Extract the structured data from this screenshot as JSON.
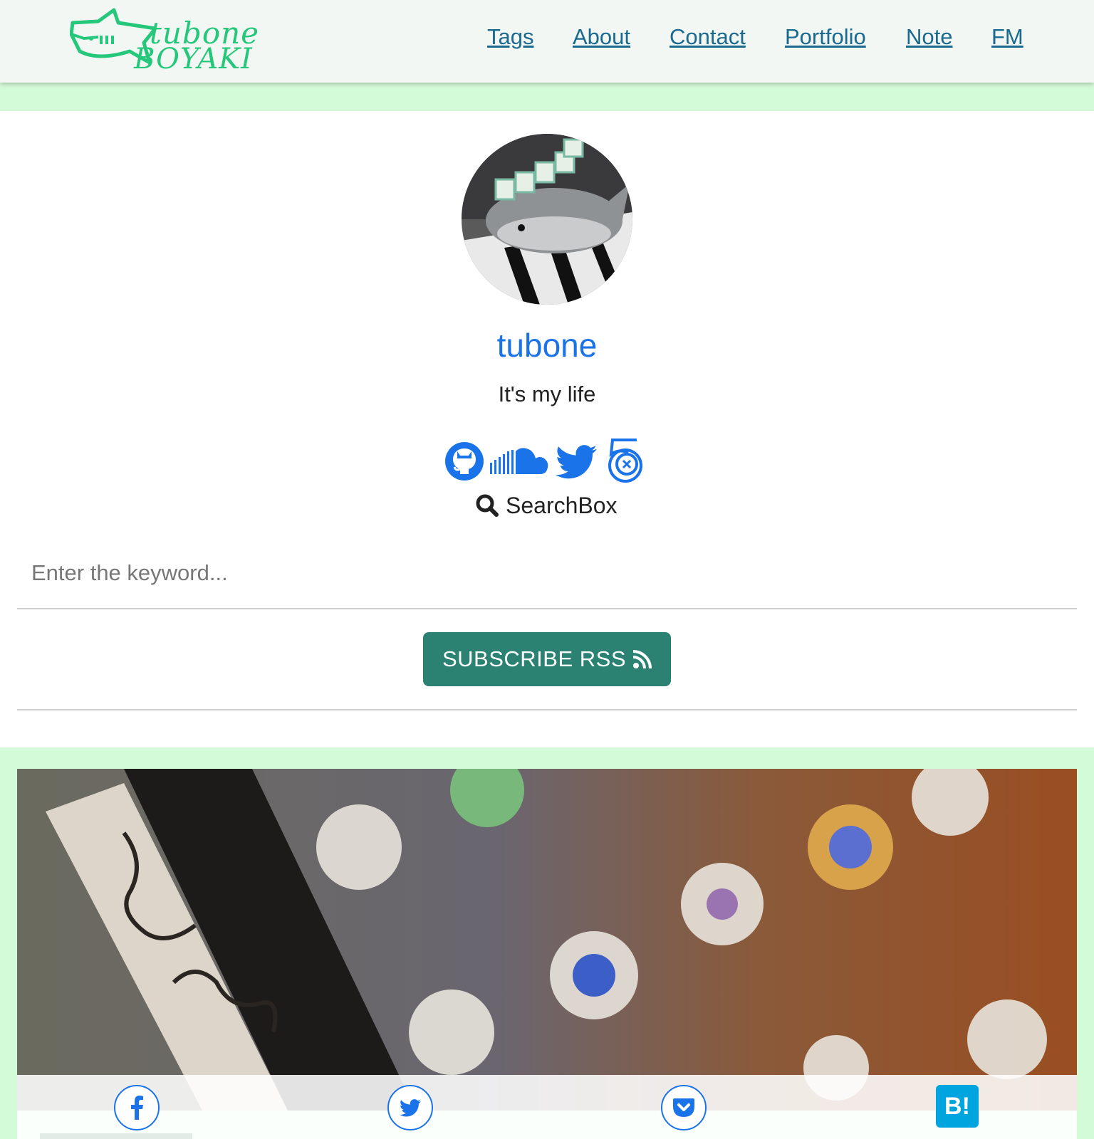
{
  "header": {
    "logo": {
      "line1": "tubone",
      "line2": "BOYAKI"
    },
    "nav": [
      {
        "label": "Tags"
      },
      {
        "label": "About"
      },
      {
        "label": "Contact"
      },
      {
        "label": "Portfolio"
      },
      {
        "label": "Note"
      },
      {
        "label": "FM"
      }
    ]
  },
  "profile": {
    "name": "tubone",
    "tagline": "It's my life",
    "social_icons": [
      "github-icon",
      "soundcloud-icon",
      "twitter-icon",
      "500px-icon"
    ]
  },
  "search": {
    "title": "SearchBox",
    "placeholder": "Enter the keyword...",
    "value": ""
  },
  "rss": {
    "label": "SUBSCRIBE RSS"
  },
  "share": {
    "buttons": [
      "facebook-icon",
      "twitter-icon",
      "pocket-icon",
      "hatena-bookmark-icon"
    ],
    "hatena_label": "B!"
  },
  "colors": {
    "accent_green": "#25c77a",
    "link_blue": "#1a73e8",
    "nav_link": "#1a6a8f",
    "rss_button": "#2b8273",
    "band_green": "#d4fbd8",
    "hatena_blue": "#00a4de"
  }
}
